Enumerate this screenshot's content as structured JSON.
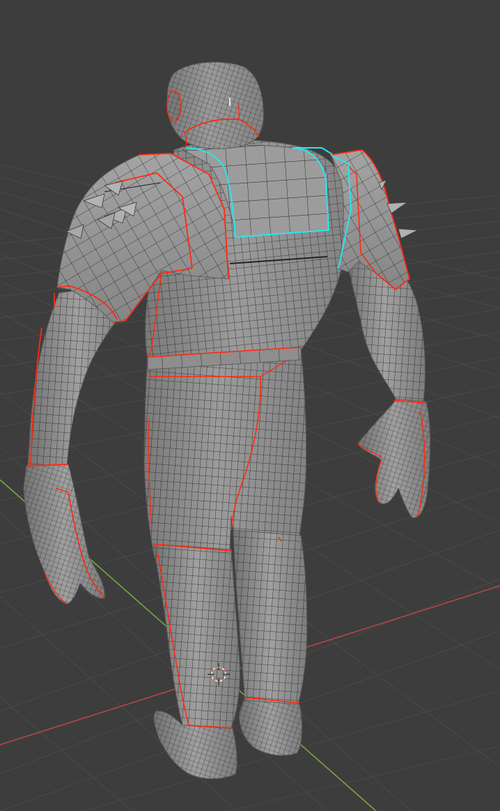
{
  "viewport": {
    "background_color": "#3d3d3d",
    "grid_color": "#4a4a4a",
    "x_axis_color": "#b4444c",
    "y_axis_color": "#7aa63c",
    "mesh_color": "#8e8e8e",
    "mesh_dark_color": "#6f6f6f",
    "wire_color": "#1f1f1f",
    "seam_color": "#ff2a10",
    "selected_color": "#29e6ee",
    "cursor_color": "#ff6a4d",
    "cursor_icon": "3d-cursor-icon",
    "object": "armored-humanoid-mesh"
  }
}
